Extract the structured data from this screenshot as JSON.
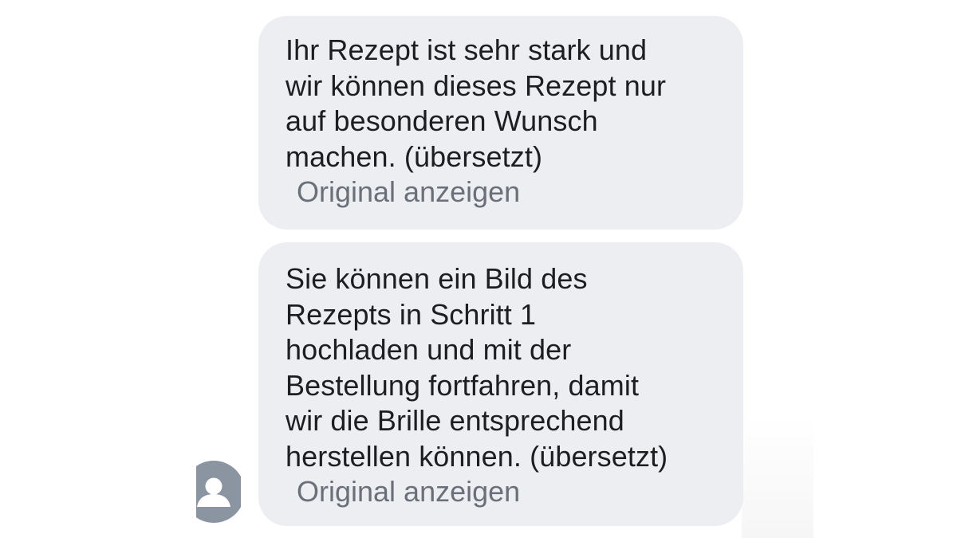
{
  "messages": [
    {
      "text": "Ihr Rezept ist sehr stark und\nwir können dieses Rezept nur\nauf besonderen Wunsch\nmachen. (übersetzt)",
      "show_original": "Original anzeigen"
    },
    {
      "text": "Sie können ein Bild des\nRezepts in Schritt 1\nhochladen und mit der\nBestellung fortfahren, damit\nwir die Brille entsprechend\nherstellen können. (übersetzt)",
      "show_original": "Original anzeigen"
    }
  ],
  "avatar": {
    "icon": "default-user-avatar-icon",
    "color": "#8b95a1"
  },
  "colors": {
    "bubble_background": "#eceef1",
    "text": "#1c1e21",
    "link": "#6a7079"
  }
}
